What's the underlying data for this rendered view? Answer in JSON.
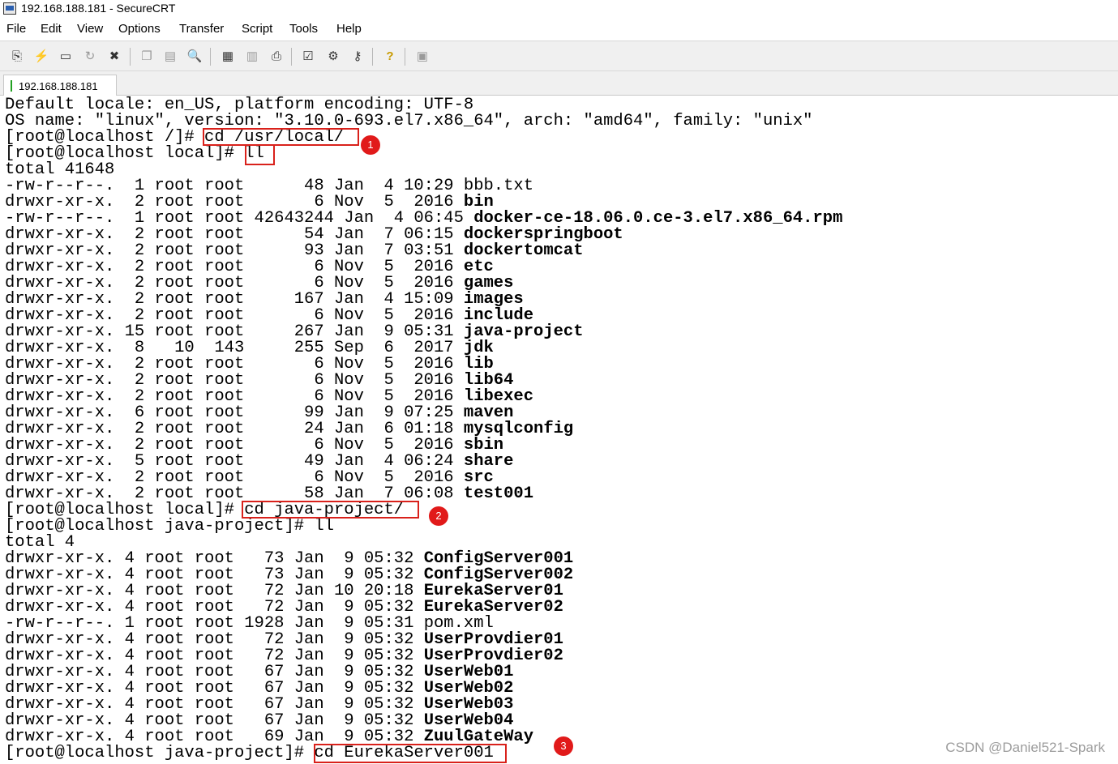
{
  "window": {
    "title": "192.168.188.181 - SecureCRT"
  },
  "menu": [
    "File",
    "Edit",
    "View",
    "Options",
    "Transfer",
    "Script",
    "Tools",
    "Help"
  ],
  "toolbar": [
    {
      "icon": "connect-icon"
    },
    {
      "icon": "quick-connect-icon"
    },
    {
      "icon": "connect-in-tab-icon"
    },
    {
      "icon": "reconnect-icon"
    },
    {
      "icon": "disconnect-icon"
    },
    {
      "icon": "copy-icon"
    },
    {
      "icon": "paste-icon"
    },
    {
      "icon": "find-icon"
    },
    {
      "icon": "print-icon"
    },
    {
      "icon": "print-selection-icon"
    },
    {
      "icon": "printer-icon"
    },
    {
      "icon": "session-options-icon"
    },
    {
      "icon": "global-options-icon"
    },
    {
      "icon": "keymap-icon"
    },
    {
      "icon": "help-icon"
    },
    {
      "icon": "sftp-icon"
    }
  ],
  "tab": {
    "label": "192.168.188.181"
  },
  "terminal": {
    "lines": [
      {
        "text": "Default locale: en_US, platform encoding: UTF-8"
      },
      {
        "text": "OS name: \"linux\", version: \"3.10.0-693.el7.x86_64\", arch: \"amd64\", family: \"unix\""
      },
      {
        "text": "[root@localhost /]# cd /usr/local/"
      },
      {
        "text": "[root@localhost local]# ll"
      },
      {
        "text": "total 41648"
      },
      {
        "text": "-rw-r--r--.  1 root root      48 Jan  4 10:29 ",
        "name": "bbb.txt",
        "dir": false
      },
      {
        "text": "drwxr-xr-x.  2 root root       6 Nov  5  2016 ",
        "name": "bin",
        "dir": true
      },
      {
        "text": "-rw-r--r--.  1 root root 42643244 Jan  4 06:45 ",
        "name": "docker-ce-18.06.0.ce-3.el7.x86_64.rpm",
        "dir": true
      },
      {
        "text": "drwxr-xr-x.  2 root root      54 Jan  7 06:15 ",
        "name": "dockerspringboot",
        "dir": true
      },
      {
        "text": "drwxr-xr-x.  2 root root      93 Jan  7 03:51 ",
        "name": "dockertomcat",
        "dir": true
      },
      {
        "text": "drwxr-xr-x.  2 root root       6 Nov  5  2016 ",
        "name": "etc",
        "dir": true
      },
      {
        "text": "drwxr-xr-x.  2 root root       6 Nov  5  2016 ",
        "name": "games",
        "dir": true
      },
      {
        "text": "drwxr-xr-x.  2 root root     167 Jan  4 15:09 ",
        "name": "images",
        "dir": true
      },
      {
        "text": "drwxr-xr-x.  2 root root       6 Nov  5  2016 ",
        "name": "include",
        "dir": true
      },
      {
        "text": "drwxr-xr-x. 15 root root     267 Jan  9 05:31 ",
        "name": "java-project",
        "dir": true
      },
      {
        "text": "drwxr-xr-x.  8   10  143     255 Sep  6  2017 ",
        "name": "jdk",
        "dir": true
      },
      {
        "text": "drwxr-xr-x.  2 root root       6 Nov  5  2016 ",
        "name": "lib",
        "dir": true
      },
      {
        "text": "drwxr-xr-x.  2 root root       6 Nov  5  2016 ",
        "name": "lib64",
        "dir": true
      },
      {
        "text": "drwxr-xr-x.  2 root root       6 Nov  5  2016 ",
        "name": "libexec",
        "dir": true
      },
      {
        "text": "drwxr-xr-x.  6 root root      99 Jan  9 07:25 ",
        "name": "maven",
        "dir": true
      },
      {
        "text": "drwxr-xr-x.  2 root root      24 Jan  6 01:18 ",
        "name": "mysqlconfig",
        "dir": true
      },
      {
        "text": "drwxr-xr-x.  2 root root       6 Nov  5  2016 ",
        "name": "sbin",
        "dir": true
      },
      {
        "text": "drwxr-xr-x.  5 root root      49 Jan  4 06:24 ",
        "name": "share",
        "dir": true
      },
      {
        "text": "drwxr-xr-x.  2 root root       6 Nov  5  2016 ",
        "name": "src",
        "dir": true
      },
      {
        "text": "drwxr-xr-x.  2 root root      58 Jan  7 06:08 ",
        "name": "test001",
        "dir": true
      },
      {
        "text": "[root@localhost local]# cd java-project/"
      },
      {
        "text": "[root@localhost java-project]# ll"
      },
      {
        "text": "total 4"
      },
      {
        "text": "drwxr-xr-x. 4 root root   73 Jan  9 05:32 ",
        "name": "ConfigServer001",
        "dir": true
      },
      {
        "text": "drwxr-xr-x. 4 root root   73 Jan  9 05:32 ",
        "name": "ConfigServer002",
        "dir": true
      },
      {
        "text": "drwxr-xr-x. 4 root root   72 Jan 10 20:18 ",
        "name": "EurekaServer01",
        "dir": true
      },
      {
        "text": "drwxr-xr-x. 4 root root   72 Jan  9 05:32 ",
        "name": "EurekaServer02",
        "dir": true
      },
      {
        "text": "-rw-r--r--. 1 root root 1928 Jan  9 05:31 ",
        "name": "pom.xml",
        "dir": false
      },
      {
        "text": "drwxr-xr-x. 4 root root   72 Jan  9 05:32 ",
        "name": "UserProvdier01",
        "dir": true
      },
      {
        "text": "drwxr-xr-x. 4 root root   72 Jan  9 05:32 ",
        "name": "UserProvdier02",
        "dir": true
      },
      {
        "text": "drwxr-xr-x. 4 root root   67 Jan  9 05:32 ",
        "name": "UserWeb01",
        "dir": true
      },
      {
        "text": "drwxr-xr-x. 4 root root   67 Jan  9 05:32 ",
        "name": "UserWeb02",
        "dir": true
      },
      {
        "text": "drwxr-xr-x. 4 root root   67 Jan  9 05:32 ",
        "name": "UserWeb03",
        "dir": true
      },
      {
        "text": "drwxr-xr-x. 4 root root   67 Jan  9 05:32 ",
        "name": "UserWeb04",
        "dir": true
      },
      {
        "text": "drwxr-xr-x. 4 root root   69 Jan  9 05:32 ",
        "name": "ZuulGateWay",
        "dir": true
      },
      {
        "text": "[root@localhost java-project]# cd EurekaServer001"
      }
    ]
  },
  "annotations": [
    {
      "label": "1"
    },
    {
      "label": "2"
    },
    {
      "label": "3"
    }
  ],
  "watermark": "CSDN @Daniel521-Spark",
  "colors": {
    "annotation": "#e11a1a",
    "tab_indicator": "#21a021"
  }
}
